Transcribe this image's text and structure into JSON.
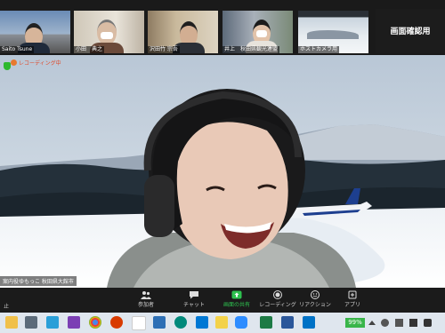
{
  "gallery": {
    "tiles": [
      {
        "name": "Saito Tsune"
      },
      {
        "name": "小田　典之"
      },
      {
        "name": "沢田竹  宗吾"
      },
      {
        "name": "井上　秋田県観光連盟"
      },
      {
        "name": "ホストカメラ用"
      },
      {
        "name": "画面確認用"
      }
    ],
    "right_label": "画面確認用"
  },
  "main_video": {
    "recording_label": "レコーディング中",
    "speaker_name": "案内役ゆもっこ 秋田県大館市"
  },
  "toolbar": {
    "items": [
      {
        "label": "参加者",
        "icon": "participants-icon"
      },
      {
        "label": "チャット",
        "icon": "chat-icon"
      },
      {
        "label": "画面の共有",
        "icon": "share-screen-icon"
      },
      {
        "label": "レコーディング",
        "icon": "record-icon"
      },
      {
        "label": "リアクション",
        "icon": "reaction-icon"
      },
      {
        "label": "アプリ",
        "icon": "apps-icon"
      }
    ],
    "participants_count": "6",
    "left_label": "止",
    "accent": "#2ec24f"
  },
  "taskbar": {
    "battery": "99%",
    "apps": [
      "file-explorer-icon",
      "calculator-icon",
      "notepad-icon",
      "onenote-icon",
      "chrome-icon",
      "office-icon",
      "paint-icon",
      "photos-icon",
      "edge-icon",
      "mail-icon",
      "zoom-icon",
      "sticky-icon",
      "excel-icon",
      "word-icon",
      "outlook-icon"
    ]
  }
}
